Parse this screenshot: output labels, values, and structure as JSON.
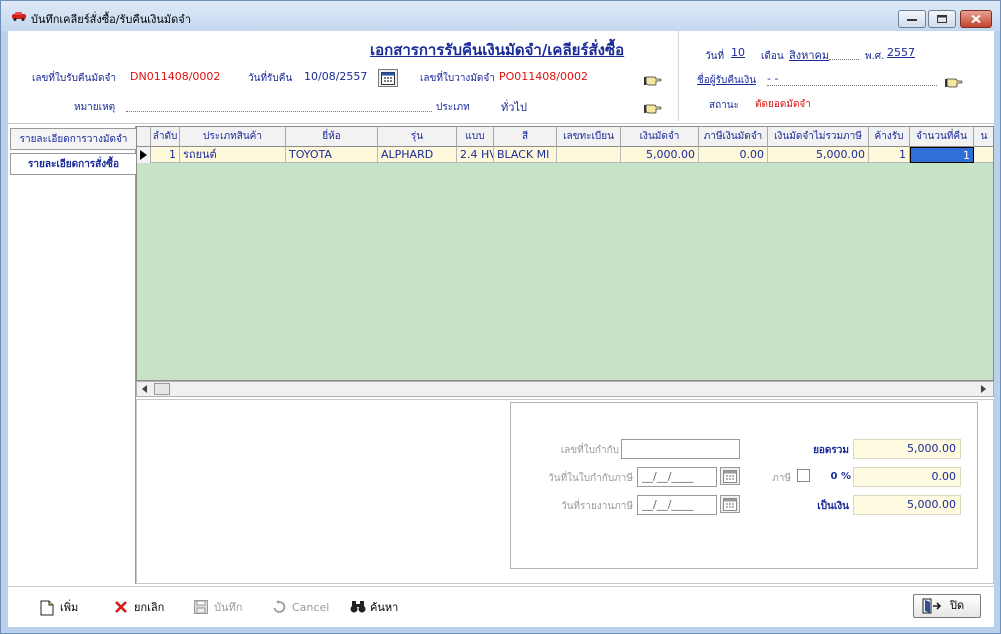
{
  "window": {
    "title": "บันทึกเคลียร์สั่งซื้อ/รับคืนเงินมัดจำ"
  },
  "header": {
    "doc_title": "เอกสารการรับคืนเงินมัดจำ/เคลียร์สั่งซื้อ",
    "refund_no_label": "เลขที่ใบรับคืนมัดจำ",
    "refund_no_value": "DN011408/0002",
    "refund_date_label": "วันที่รับคืน",
    "refund_date_value": "10/08/2557",
    "deposit_no_label": "เลขที่ใบวางมัดจำ",
    "deposit_no_value": "PO011408/0002",
    "remark_label": "หมายเหตุ",
    "type_label": "ประเภท",
    "type_value": "ทั่วไป",
    "day_label": "วันที่",
    "day_value": "10",
    "month_label": "เดือน",
    "month_value": "สิงหาคม",
    "year_label": "พ.ศ.",
    "year_value": "2557",
    "payee_label": "ชื่อผู้รับคืนเงิน",
    "payee_value": "- -",
    "status_label": "สถานะ",
    "status_value": "ตัดยอดมัดจำ"
  },
  "tabs": [
    {
      "label": "รายละเอียดการวางมัดจำ"
    },
    {
      "label": "รายละเอียดการสั่งซื้อ"
    }
  ],
  "grid": {
    "columns": [
      "ลำดับ",
      "ประเภทสินค้า",
      "ยี่ห้อ",
      "รุ่น",
      "แบบ",
      "สี",
      "เลขทะเบียน",
      "เงินมัดจำ",
      "ภาษีเงินมัดจำ",
      "เงินมัดจำไม่รวมภาษี",
      "ค้างรับ",
      "จำนวนที่คืน",
      "น"
    ],
    "rows": [
      [
        "1",
        "รถยนต์",
        "TOYOTA",
        "ALPHARD",
        "2.4 HV",
        "BLACK MI",
        "",
        "5,000.00",
        "0.00",
        "5,000.00",
        "1",
        "1",
        ""
      ]
    ]
  },
  "summary": {
    "tax_invoice_no_label": "เลขที่ใบกำกับ",
    "tax_invoice_no_value": "",
    "tax_invoice_date_label": "วันที่ในใบกำกับภาษี",
    "tax_invoice_date_value": "__/__/____",
    "tax_report_date_label": "วันที่รายงานภาษี",
    "tax_report_date_value": "__/__/____",
    "total_label": "ยอดรวม",
    "total_value": "5,000.00",
    "tax_label": "ภาษี",
    "tax_rate": "0 %",
    "tax_value": "0.00",
    "net_label": "เป็นเงิน",
    "net_value": "5,000.00"
  },
  "toolbar": {
    "add_label": "เพิ่ม",
    "cancel_doc_label": "ยกเลิก",
    "save_label": "บันทึก",
    "cancel_label": "Cancel",
    "search_label": "ค้นหา",
    "close_label": "ปิด"
  },
  "colors": {
    "accent_blue": "#1a2a99",
    "value_red": "#e01010",
    "grid_bg": "#c7e2c7",
    "row_bg": "#fff9dc",
    "selection": "#2f6fd6"
  }
}
